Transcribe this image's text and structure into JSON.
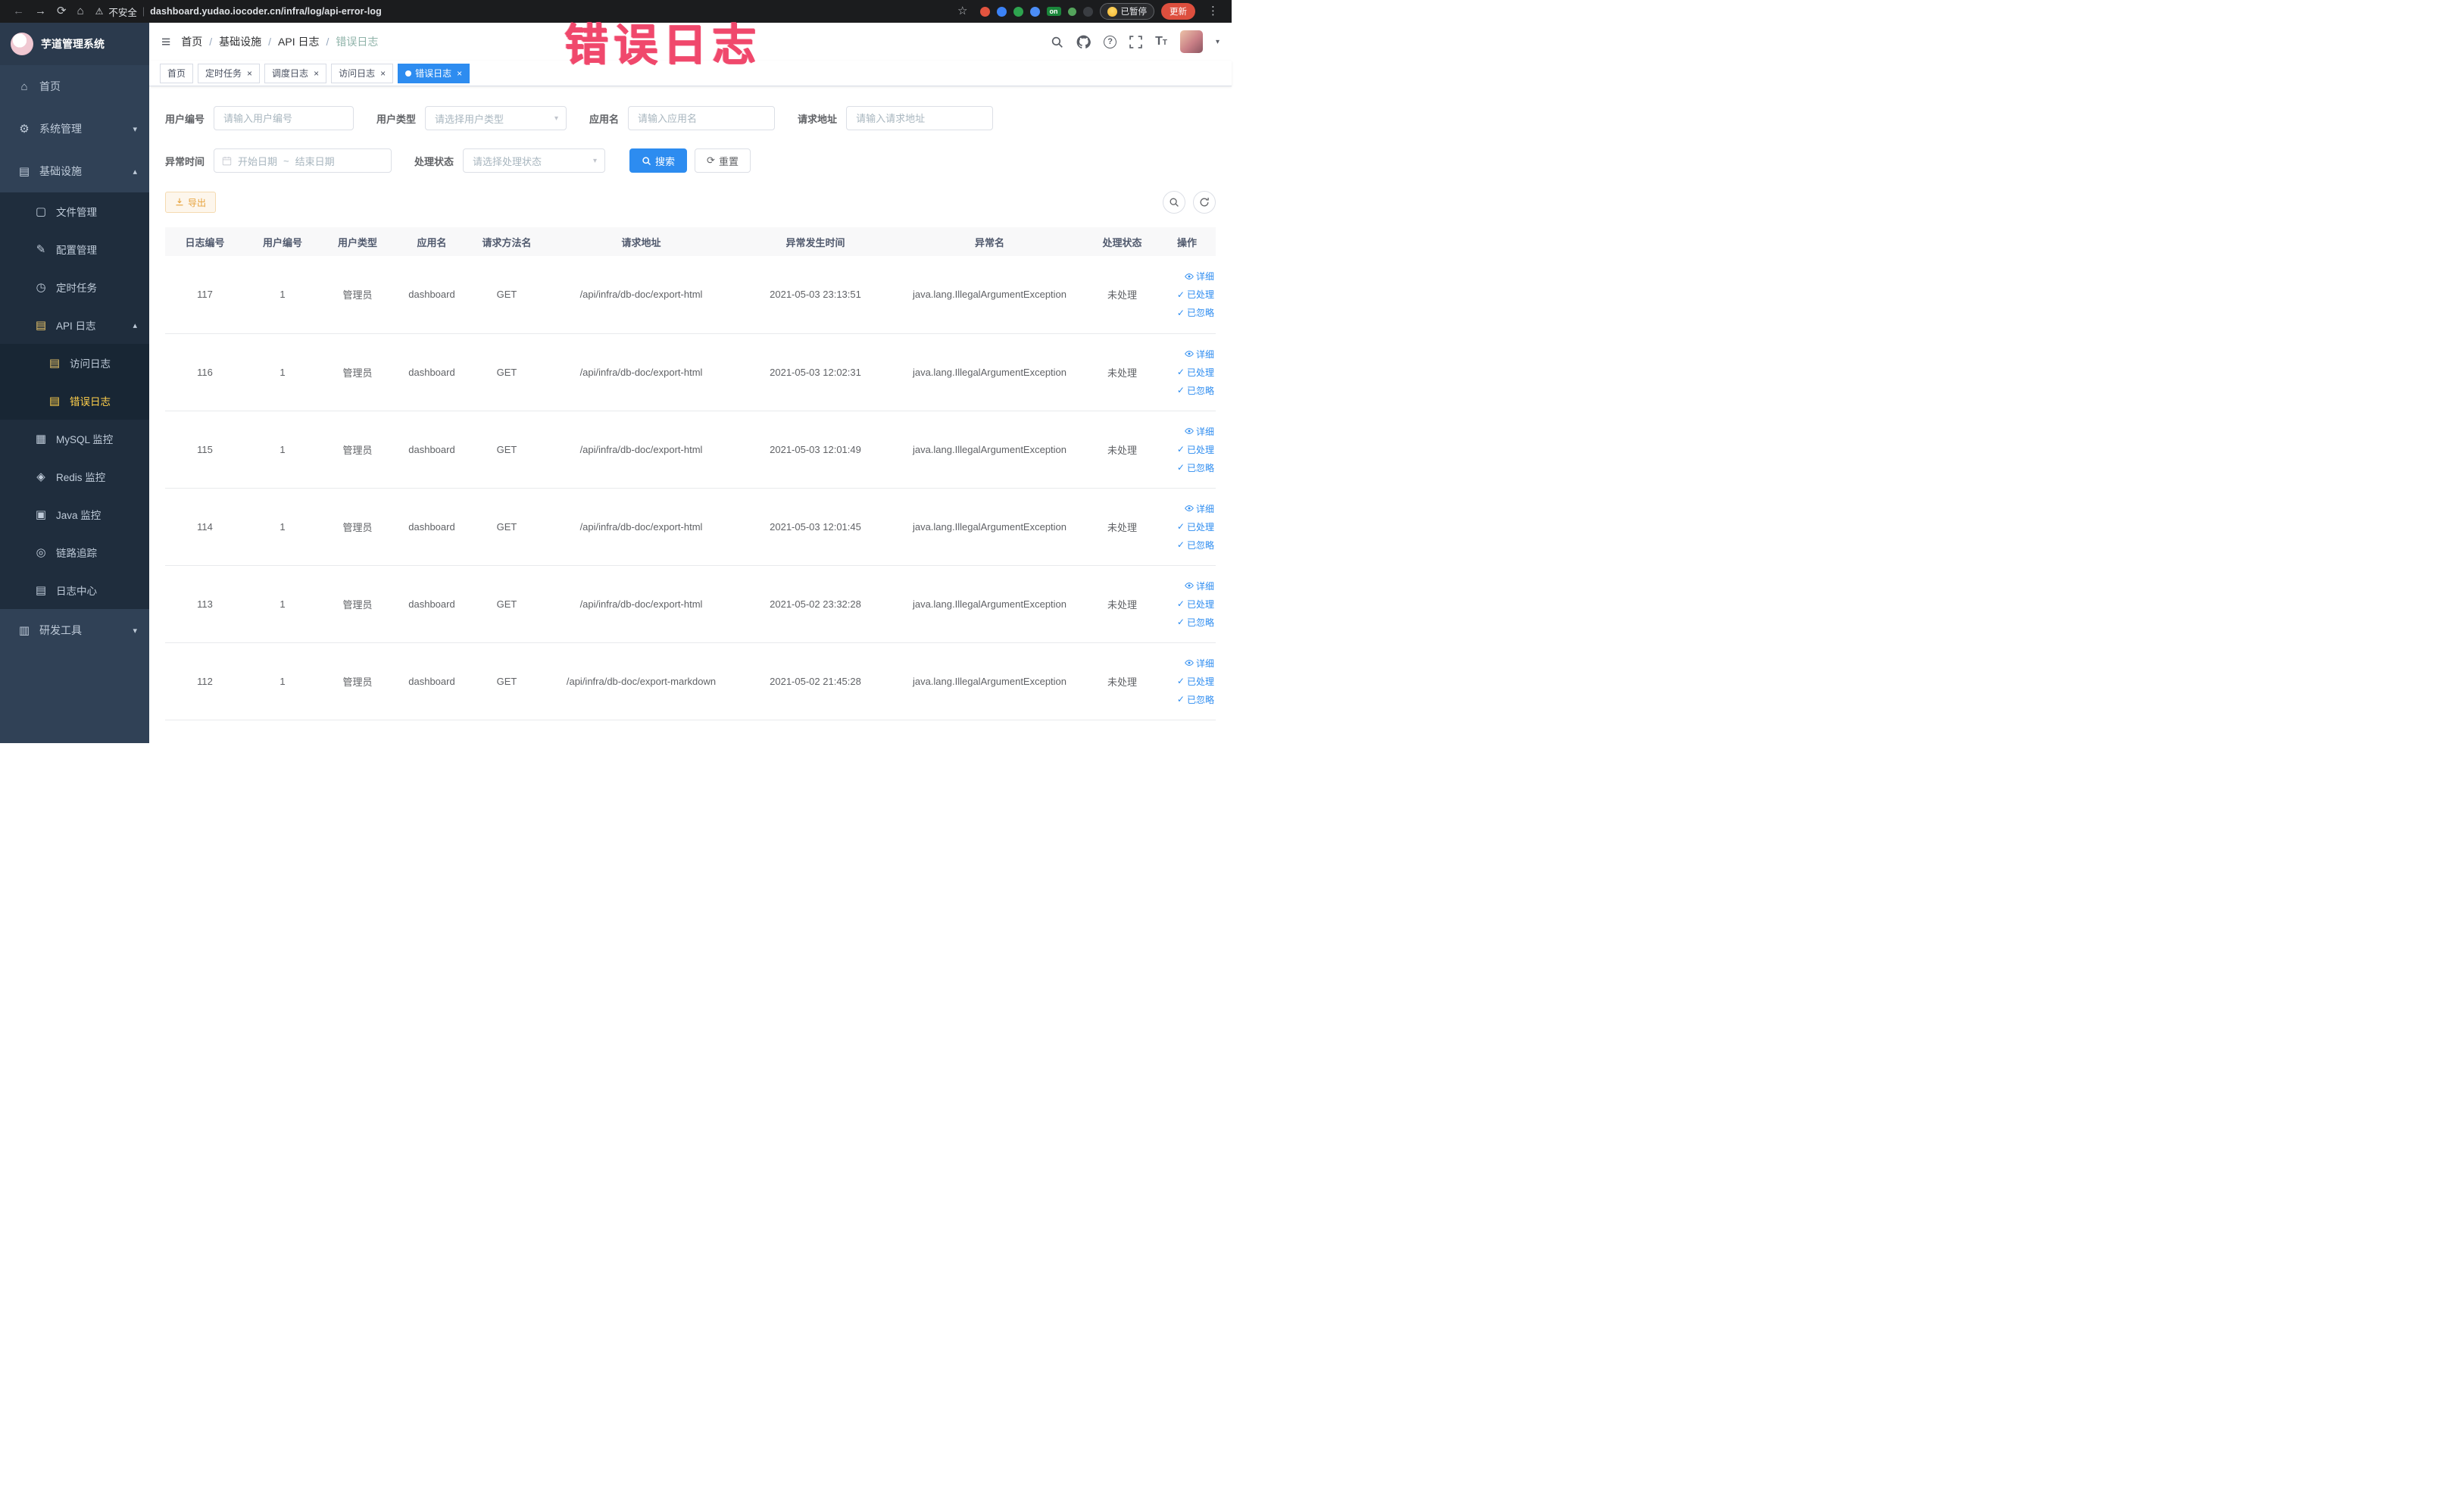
{
  "annotation": {
    "title": "错误日志"
  },
  "browser": {
    "security_label": "不安全",
    "url": "dashboard.yudao.iocoder.cn/infra/log/api-error-log",
    "extension_badge_on": "on",
    "paused_badge": "已暂停",
    "update_button": "更新"
  },
  "sidebar": {
    "app_title": "芋道管理系统",
    "menu": [
      {
        "label": "首页"
      },
      {
        "label": "系统管理"
      },
      {
        "label": "基础设施"
      },
      {
        "label": "文件管理"
      },
      {
        "label": "配置管理"
      },
      {
        "label": "定时任务"
      },
      {
        "label": "API 日志"
      },
      {
        "label": "访问日志"
      },
      {
        "label": "错误日志"
      },
      {
        "label": "MySQL 监控"
      },
      {
        "label": "Redis 监控"
      },
      {
        "label": "Java 监控"
      },
      {
        "label": "链路追踪"
      },
      {
        "label": "日志中心"
      },
      {
        "label": "研发工具"
      }
    ]
  },
  "breadcrumb": {
    "items": [
      "首页",
      "基础设施",
      "API 日志",
      "错误日志"
    ],
    "separator": "/"
  },
  "tabs": [
    {
      "label": "首页"
    },
    {
      "label": "定时任务"
    },
    {
      "label": "调度日志"
    },
    {
      "label": "访问日志"
    },
    {
      "label": "错误日志"
    }
  ],
  "filters": {
    "user_id_label": "用户编号",
    "user_id_placeholder": "请输入用户编号",
    "user_type_label": "用户类型",
    "user_type_placeholder": "请选择用户类型",
    "app_name_label": "应用名",
    "app_name_placeholder": "请输入应用名",
    "request_url_label": "请求地址",
    "request_url_placeholder": "请输入请求地址",
    "exception_time_label": "异常时间",
    "date_start_placeholder": "开始日期",
    "date_separator": "~",
    "date_end_placeholder": "结束日期",
    "status_label": "处理状态",
    "status_placeholder": "请选择处理状态",
    "search_button": "搜索",
    "reset_button": "重置"
  },
  "toolbar": {
    "export_button": "导出"
  },
  "table": {
    "columns": [
      "日志编号",
      "用户编号",
      "用户类型",
      "应用名",
      "请求方法名",
      "请求地址",
      "异常发生时间",
      "异常名",
      "处理状态",
      "操作"
    ],
    "actions": {
      "detail": "详细",
      "processed": "已处理",
      "ignored": "已忽略"
    },
    "rows": [
      {
        "id": "117",
        "user_id": "1",
        "user_type": "管理员",
        "app_name": "dashboard",
        "method": "GET",
        "url": "/api/infra/db-doc/export-html",
        "time": "2021-05-03 23:13:51",
        "exception": "java.lang.IllegalArgumentException",
        "status": "未处理"
      },
      {
        "id": "116",
        "user_id": "1",
        "user_type": "管理员",
        "app_name": "dashboard",
        "method": "GET",
        "url": "/api/infra/db-doc/export-html",
        "time": "2021-05-03 12:02:31",
        "exception": "java.lang.IllegalArgumentException",
        "status": "未处理"
      },
      {
        "id": "115",
        "user_id": "1",
        "user_type": "管理员",
        "app_name": "dashboard",
        "method": "GET",
        "url": "/api/infra/db-doc/export-html",
        "time": "2021-05-03 12:01:49",
        "exception": "java.lang.IllegalArgumentException",
        "status": "未处理"
      },
      {
        "id": "114",
        "user_id": "1",
        "user_type": "管理员",
        "app_name": "dashboard",
        "method": "GET",
        "url": "/api/infra/db-doc/export-html",
        "time": "2021-05-03 12:01:45",
        "exception": "java.lang.IllegalArgumentException",
        "status": "未处理"
      },
      {
        "id": "113",
        "user_id": "1",
        "user_type": "管理员",
        "app_name": "dashboard",
        "method": "GET",
        "url": "/api/infra/db-doc/export-html",
        "time": "2021-05-02 23:32:28",
        "exception": "java.lang.IllegalArgumentException",
        "status": "未处理"
      },
      {
        "id": "112",
        "user_id": "1",
        "user_type": "管理员",
        "app_name": "dashboard",
        "method": "GET",
        "url": "/api/infra/db-doc/export-markdown",
        "time": "2021-05-02 21:45:28",
        "exception": "java.lang.IllegalArgumentException",
        "status": "未处理"
      }
    ]
  },
  "icons": {
    "back": "←",
    "forward": "→",
    "reload": "⟳",
    "home": "⌂",
    "star": "☆",
    "warning": "⚠",
    "menu_dots": "⋮",
    "hamburger": "≡",
    "caret_down": "▾",
    "caret_up": "▴",
    "close": "×",
    "check": "✓",
    "question": "?",
    "font_size_big": "T",
    "font_size_small": "T",
    "refresh": "⟳",
    "menu_home": "⌂",
    "menu_system": "⚙",
    "menu_infra": "▤",
    "menu_file": "▢",
    "menu_config": "✎",
    "menu_job": "◷",
    "menu_api_log": "▤",
    "menu_access_log": "▤",
    "menu_error_log": "▤",
    "menu_mysql": "▦",
    "menu_redis": "◈",
    "menu_java": "▣",
    "menu_trace": "◎",
    "menu_log_center": "▤",
    "menu_devtools": "▥"
  },
  "colors": {
    "accent_blue": "#2d8cf0",
    "sidebar_bg": "#304156",
    "submenu_bg": "#1f2d3d",
    "active_yellow": "#ffd04b",
    "warning_orange": "#e6a23c",
    "annotation_red": "#f0486c"
  }
}
